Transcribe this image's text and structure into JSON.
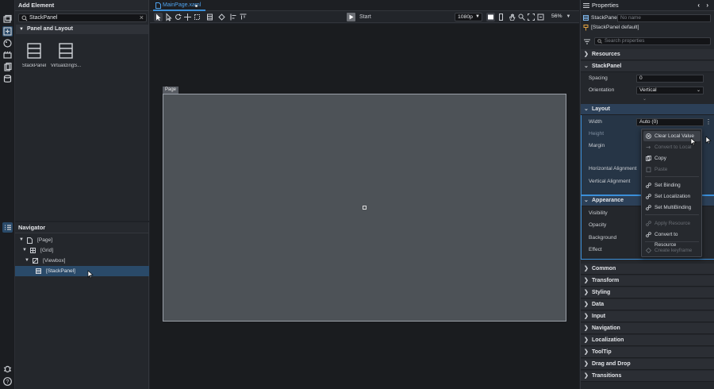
{
  "add_element": {
    "title": "Add Element",
    "search_value": "StackPanel",
    "group_label": "Panel and Layout",
    "tiles": [
      {
        "label": "StackPanel"
      },
      {
        "label": "VirtualizingS..."
      }
    ]
  },
  "navigator": {
    "title": "Navigator",
    "items": [
      {
        "label": "[Page]"
      },
      {
        "label": "[Grid]"
      },
      {
        "label": "[Viewbox]"
      },
      {
        "label": "[StackPanel]"
      }
    ]
  },
  "editor": {
    "tab_label": "MainPage.xaml",
    "start_label": "Start",
    "resolution": "1080p",
    "zoom": "56%",
    "page_label": "Page"
  },
  "properties": {
    "title": "Properties",
    "type_name": "StackPanel",
    "name_placeholder": "No name",
    "style_label": "[StackPanel default]",
    "search_placeholder": "Search properties",
    "sections": {
      "resources": "Resources",
      "stackpanel": "StackPanel",
      "layout": "Layout",
      "appearance": "Appearance",
      "common": "Common",
      "transform": "Transform",
      "styling": "Styling",
      "data": "Data",
      "input": "Input",
      "navigation": "Navigation",
      "localization": "Localization",
      "tooltip": "ToolTip",
      "dragdrop": "Drag and Drop",
      "transitions": "Transitions"
    },
    "stackpanel_props": {
      "spacing_label": "Spacing",
      "spacing_value": "0",
      "orientation_label": "Orientation",
      "orientation_value": "Vertical"
    },
    "layout_props": {
      "width_label": "Width",
      "width_value": "Auto (0)",
      "height_label": "Height",
      "margin_label": "Margin",
      "halign_label": "Horizontal Alignment",
      "valign_label": "Vertical Alignment"
    },
    "appearance_props": {
      "visibility_label": "Visibility",
      "opacity_label": "Opacity",
      "background_label": "Background",
      "effect_label": "Effect"
    }
  },
  "context_menu": {
    "items": [
      {
        "label": "Clear Local Value",
        "icon": "clear-icon",
        "enabled": true
      },
      {
        "label": "Convert to Local",
        "icon": "convert-icon",
        "enabled": false
      },
      {
        "label": "Copy",
        "icon": "copy-icon",
        "enabled": true
      },
      {
        "label": "Paste",
        "icon": "paste-icon",
        "enabled": false
      },
      {
        "label": "Set Binding",
        "icon": "binding-icon",
        "enabled": true
      },
      {
        "label": "Set Localization",
        "icon": "localization-icon",
        "enabled": true
      },
      {
        "label": "Set MultiBinding",
        "icon": "multibinding-icon",
        "enabled": true
      },
      {
        "label": "Apply Resource",
        "icon": "resource-icon",
        "enabled": false
      },
      {
        "label": "Convert to Resource",
        "icon": "convert-resource-icon",
        "enabled": true
      },
      {
        "label": "Create keyframe",
        "icon": "keyframe-icon",
        "enabled": false
      }
    ]
  },
  "colors": {
    "accent": "#3b8fd9",
    "selection": "#2a4a69",
    "panel": "#24272c",
    "page_surface": "#4d5257"
  }
}
